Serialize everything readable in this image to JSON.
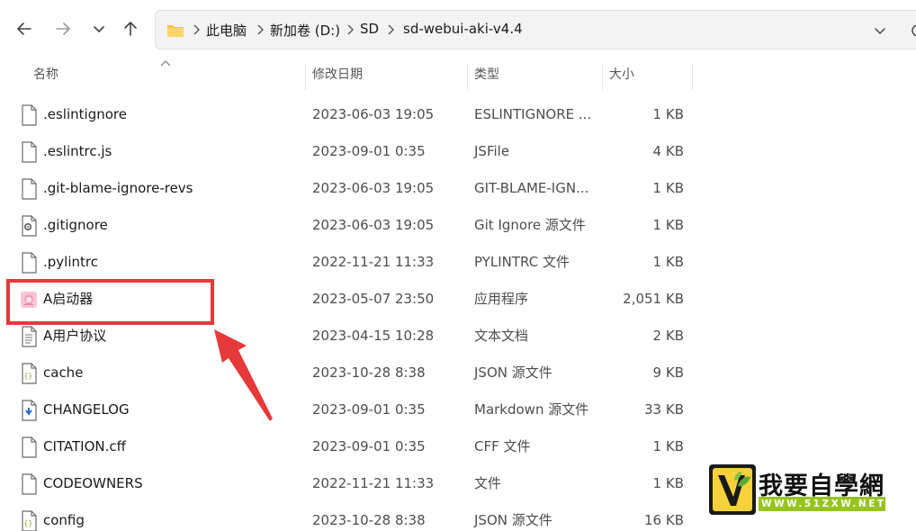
{
  "address": {
    "crumbs": [
      "此电脑",
      "新加卷 (D:)",
      "SD",
      "sd-webui-aki-v4.4"
    ]
  },
  "columns": {
    "name": "名称",
    "date": "修改日期",
    "type": "类型",
    "size": "大小"
  },
  "files": [
    {
      "name": ".eslintignore",
      "date": "2023-06-03 19:05",
      "type": "ESLINTIGNORE ...",
      "size": "1 KB",
      "icon": "file-icon"
    },
    {
      "name": ".eslintrc.js",
      "date": "2023-09-01 0:35",
      "type": "JSFile",
      "size": "4 KB",
      "icon": "file-icon"
    },
    {
      "name": ".git-blame-ignore-revs",
      "date": "2023-06-03 19:05",
      "type": "GIT-BLAME-IGN...",
      "size": "1 KB",
      "icon": "file-icon"
    },
    {
      "name": ".gitignore",
      "date": "2023-06-03 19:05",
      "type": "Git Ignore 源文件",
      "size": "1 KB",
      "icon": "gear-file-icon"
    },
    {
      "name": ".pylintrc",
      "date": "2022-11-21 11:33",
      "type": "PYLINTRC 文件",
      "size": "1 KB",
      "icon": "file-icon"
    },
    {
      "name": "A启动器",
      "date": "2023-05-07 23:50",
      "type": "应用程序",
      "size": "2,051 KB",
      "icon": "app-icon"
    },
    {
      "name": "A用户协议",
      "date": "2023-04-15 10:28",
      "type": "文本文档",
      "size": "2 KB",
      "icon": "text-file-icon"
    },
    {
      "name": "cache",
      "date": "2023-10-28 8:38",
      "type": "JSON 源文件",
      "size": "9 KB",
      "icon": "json-file-icon"
    },
    {
      "name": "CHANGELOG",
      "date": "2023-09-01 0:35",
      "type": "Markdown 源文件",
      "size": "33 KB",
      "icon": "markdown-file-icon"
    },
    {
      "name": "CITATION.cff",
      "date": "2023-09-01 0:35",
      "type": "CFF 文件",
      "size": "1 KB",
      "icon": "file-icon"
    },
    {
      "name": "CODEOWNERS",
      "date": "2022-11-21 11:33",
      "type": "文件",
      "size": "1 KB",
      "icon": "file-icon"
    },
    {
      "name": "config",
      "date": "2023-10-28 8:38",
      "type": "JSON 源文件",
      "size": "16 KB",
      "icon": "json-file-icon"
    }
  ],
  "watermark": {
    "title": "我要自學網",
    "sub": "WWW.51ZXW.NET"
  },
  "colors": {
    "highlight": "#e5393a",
    "folder": "#f5c443"
  }
}
